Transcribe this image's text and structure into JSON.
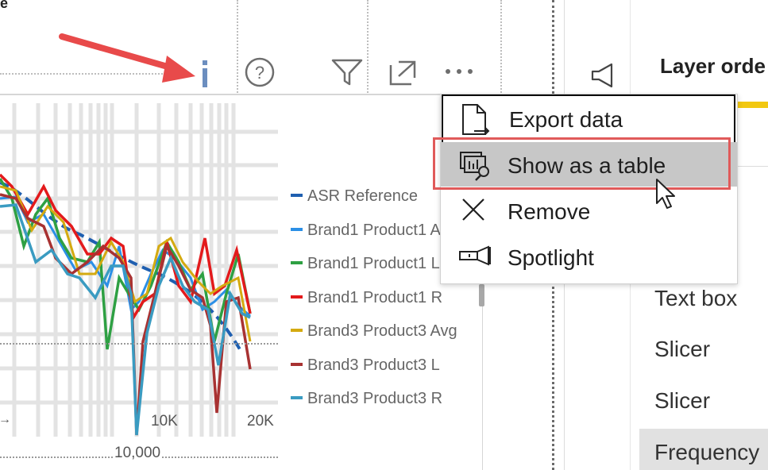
{
  "visual_header": {
    "icons": [
      "info-icon",
      "help-icon",
      "filter-icon",
      "focus-mode-icon",
      "more-options-icon"
    ]
  },
  "chart": {
    "legend": [
      {
        "label": "ASR Reference",
        "color": "#1f5fb0"
      },
      {
        "label": "Brand1 Product1 A",
        "color": "#2b8fe6"
      },
      {
        "label": "Brand1 Product1 L",
        "color": "#2ea043"
      },
      {
        "label": "Brand1 Product1 R",
        "color": "#e31a1c"
      },
      {
        "label": "Brand3 Product3 Avg",
        "color": "#d4aa10"
      },
      {
        "label": "Brand3 Product3 L",
        "color": "#a83232"
      },
      {
        "label": "Brand3 Product3 R",
        "color": "#3a9bc1"
      }
    ],
    "x_ticks": [
      "10K",
      "20K"
    ],
    "x_axis_bottom_label": "10,000",
    "left_arrow_glyph": "→"
  },
  "context_menu": {
    "items": [
      {
        "label": "Export data",
        "icon": "export-data-icon"
      },
      {
        "label": "Show as a table",
        "icon": "show-table-icon"
      },
      {
        "label": "Remove",
        "icon": "remove-x-icon"
      },
      {
        "label": "Spotlight",
        "icon": "spotlight-icon"
      }
    ]
  },
  "right_pane": {
    "title": "Layer orde",
    "items": [
      "Text box",
      "Slicer",
      "Slicer",
      "Frequency"
    ],
    "accent_color": "#f2c811"
  },
  "annotation": {
    "arrow_color": "#e84a4a",
    "highlight_color": "#e05a5a"
  }
}
